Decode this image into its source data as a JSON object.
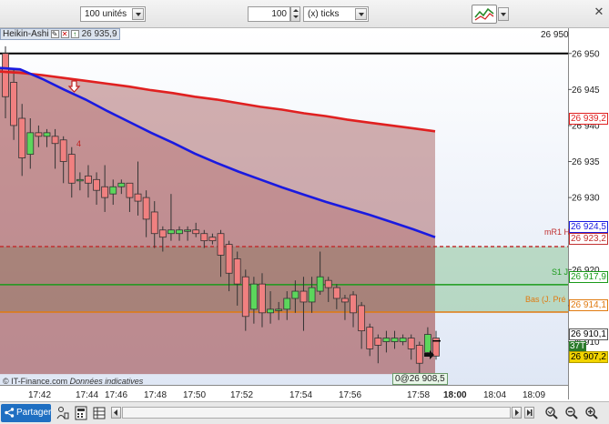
{
  "toolbar": {
    "units_value": "100 unités",
    "ticks_value": "100",
    "ticks_label": "(x) ticks",
    "close_glyph": "✕"
  },
  "indicator": {
    "name": "Heikin-Ashi",
    "value": "26 935,9"
  },
  "chart_data": {
    "type": "candlestick",
    "title": "",
    "y_ticks": [
      26950,
      26945,
      26940,
      26935,
      26930,
      26925,
      26920,
      26915,
      26910
    ],
    "y_range": [
      26904,
      26953
    ],
    "x_ticks": [
      "17:42",
      "17:44",
      "17:46",
      "17:48",
      "17:50",
      "17:52",
      "17:54",
      "17:56",
      "17:58",
      "18:00",
      "18:04",
      "18:09"
    ],
    "candles": [
      {
        "o": 26950.0,
        "c": 26944.0,
        "h": 26951.0,
        "l": 26941.0
      },
      {
        "o": 26946.0,
        "c": 26940.0,
        "h": 26948.0,
        "l": 26938.0
      },
      {
        "o": 26941.0,
        "c": 26935.5,
        "h": 26943.0,
        "l": 26933.0
      },
      {
        "o": 26936.0,
        "c": 26939.0,
        "h": 26941.0,
        "l": 26934.0
      },
      {
        "o": 26939.0,
        "c": 26938.5,
        "h": 26940.0,
        "l": 26937.0
      },
      {
        "o": 26938.5,
        "c": 26939.0,
        "h": 26939.5,
        "l": 26937.0
      },
      {
        "o": 26938.5,
        "c": 26937.5,
        "h": 26939.5,
        "l": 26934.0
      },
      {
        "o": 26938.0,
        "c": 26935.0,
        "h": 26938.5,
        "l": 26932.0
      },
      {
        "o": 26936.0,
        "c": 26932.0,
        "h": 26937.0,
        "l": 26930.0
      },
      {
        "o": 26932.5,
        "c": 26932.5,
        "h": 26933.5,
        "l": 26931.0
      },
      {
        "o": 26933.0,
        "c": 26932.0,
        "h": 26934.5,
        "l": 26930.0
      },
      {
        "o": 26932.5,
        "c": 26931.0,
        "h": 26933.5,
        "l": 26929.0
      },
      {
        "o": 26931.5,
        "c": 26930.0,
        "h": 26934.5,
        "l": 26928.0
      },
      {
        "o": 26930.5,
        "c": 26931.5,
        "h": 26932.5,
        "l": 26929.0
      },
      {
        "o": 26931.5,
        "c": 26932.0,
        "h": 26932.5,
        "l": 26930.5
      },
      {
        "o": 26932.0,
        "c": 26930.0,
        "h": 26932.0,
        "l": 26928.0
      },
      {
        "o": 26930.5,
        "c": 26929.5,
        "h": 26935.0,
        "l": 26927.5
      },
      {
        "o": 26930.0,
        "c": 26927.0,
        "h": 26931.0,
        "l": 26924.5
      },
      {
        "o": 26928.0,
        "c": 26925.0,
        "h": 26929.5,
        "l": 26923.0
      },
      {
        "o": 26925.5,
        "c": 26924.5,
        "h": 26926.0,
        "l": 26922.5
      },
      {
        "o": 26925.0,
        "c": 26925.5,
        "h": 26930.5,
        "l": 26924.0
      },
      {
        "o": 26925.0,
        "c": 26925.5,
        "h": 26926.0,
        "l": 26924.0
      },
      {
        "o": 26925.5,
        "c": 26925.5,
        "h": 26926.0,
        "l": 26924.0
      },
      {
        "o": 26925.5,
        "c": 26925.0,
        "h": 26926.5,
        "l": 26924.5
      },
      {
        "o": 26925.0,
        "c": 26924.0,
        "h": 26925.5,
        "l": 26923.0
      },
      {
        "o": 26924.5,
        "c": 26924.0,
        "h": 26925.0,
        "l": 26923.5
      },
      {
        "o": 26925.0,
        "c": 26922.0,
        "h": 26925.5,
        "l": 26919.0
      },
      {
        "o": 26923.5,
        "c": 26919.5,
        "h": 26924.0,
        "l": 26917.0
      },
      {
        "o": 26921.5,
        "c": 26918.0,
        "h": 26922.5,
        "l": 26915.0
      },
      {
        "o": 26919.0,
        "c": 26913.5,
        "h": 26920.0,
        "l": 26911.5
      },
      {
        "o": 26914.5,
        "c": 26918.0,
        "h": 26919.0,
        "l": 26912.5
      },
      {
        "o": 26918.0,
        "c": 26914.0,
        "h": 26919.5,
        "l": 26912.0
      },
      {
        "o": 26914.0,
        "c": 26914.5,
        "h": 26917.0,
        "l": 26912.5
      },
      {
        "o": 26914.5,
        "c": 26914.5,
        "h": 26915.5,
        "l": 26913.0
      },
      {
        "o": 26914.5,
        "c": 26916.0,
        "h": 26917.0,
        "l": 26913.0
      },
      {
        "o": 26916.0,
        "c": 26917.0,
        "h": 26918.5,
        "l": 26914.0
      },
      {
        "o": 26917.0,
        "c": 26915.5,
        "h": 26919.0,
        "l": 26911.5
      },
      {
        "o": 26915.5,
        "c": 26917.5,
        "h": 26919.0,
        "l": 26914.0
      },
      {
        "o": 26917.0,
        "c": 26919.0,
        "h": 26922.5,
        "l": 26916.5
      },
      {
        "o": 26918.5,
        "c": 26917.5,
        "h": 26919.0,
        "l": 26915.5
      },
      {
        "o": 26917.5,
        "c": 26916.0,
        "h": 26918.0,
        "l": 26914.5
      },
      {
        "o": 26916.0,
        "c": 26915.5,
        "h": 26916.5,
        "l": 26913.0
      },
      {
        "o": 26916.5,
        "c": 26914.0,
        "h": 26917.0,
        "l": 26912.0
      },
      {
        "o": 26915.0,
        "c": 26911.5,
        "h": 26915.5,
        "l": 26909.0
      },
      {
        "o": 26912.0,
        "c": 26909.0,
        "h": 26912.5,
        "l": 26908.0
      },
      {
        "o": 26910.5,
        "c": 26909.5,
        "h": 26911.0,
        "l": 26907.0
      },
      {
        "o": 26910.0,
        "c": 26910.5,
        "h": 26911.5,
        "l": 26908.5
      },
      {
        "o": 26910.0,
        "c": 26910.5,
        "h": 26911.5,
        "l": 26909.0
      },
      {
        "o": 26910.0,
        "c": 26910.5,
        "h": 26911.0,
        "l": 26909.5
      },
      {
        "o": 26910.5,
        "c": 26909.0,
        "h": 26911.0,
        "l": 26907.5
      },
      {
        "o": 26909.5,
        "c": 26907.0,
        "h": 26910.0,
        "l": 26905.0
      },
      {
        "o": 26908.5,
        "c": 26911.0,
        "h": 26912.0,
        "l": 26908.0
      },
      {
        "o": 26910.5,
        "c": 26908.0,
        "h": 26911.5,
        "l": 26907.5
      }
    ],
    "series": [
      {
        "name": "MA long",
        "color": "#e02020",
        "values": [
          26947.5,
          26947.3,
          26947.0,
          26946.6,
          26946.2,
          26945.8,
          26945.4,
          26944.9,
          26944.5,
          26944.0,
          26943.6,
          26943.1,
          26942.6,
          26942.2,
          26941.7,
          26941.3,
          26940.8,
          26940.4,
          26940.0,
          26939.6,
          26939.2
        ]
      },
      {
        "name": "MA short",
        "color": "#1a1ae0",
        "values": [
          26948.0,
          26947.8,
          26946.5,
          26945.0,
          26943.6,
          26942.0,
          26940.5,
          26939.0,
          26937.6,
          26936.1,
          26934.8,
          26933.6,
          26932.5,
          26931.4,
          26930.4,
          26929.4,
          26928.5,
          26927.6,
          26926.6,
          26925.6,
          26924.5
        ]
      }
    ],
    "levels": [
      {
        "name": "mR1 H",
        "value": 26923.2,
        "label": "26 923,2",
        "color": "#c03030",
        "fill": "#8fc79a"
      },
      {
        "name": "S1 J",
        "value": 26917.9,
        "label": "26 917,9",
        "color": "#1a9a1a"
      },
      {
        "name": "Bas (J. Pré",
        "value": 26914.1,
        "label": "26 914,1",
        "color": "#e07a10"
      }
    ],
    "markers": [
      {
        "label": "4",
        "color": "#c02020"
      }
    ],
    "price_labels": {
      "top_line": "26 950",
      "ma_long": "26 939,2",
      "ma_short": "26 924,5",
      "last": "26 910,1",
      "bid": "26 907,2",
      "countdown": "37T",
      "cursor": "0@26 908,5"
    },
    "watermark": "© IT-Finance.com",
    "watermark_note": "Données indicatives"
  },
  "bottombar": {
    "share_label": "Partager"
  },
  "colors": {
    "bull": "#5cd65c",
    "bear": "#f08080",
    "candle_border": "#333333"
  }
}
